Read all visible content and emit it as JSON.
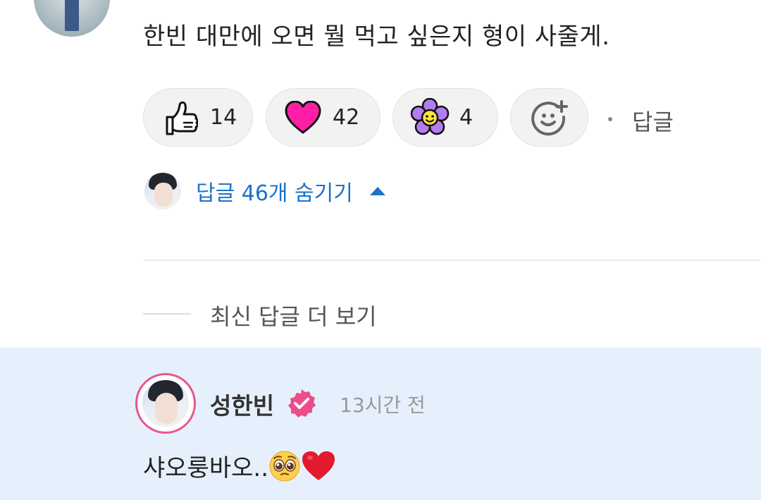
{
  "comment": {
    "text": "한빈 대만에 오면 뭘 먹고 싶은지 형이 사줄게."
  },
  "reactions": [
    {
      "icon": "thumbs-up-icon",
      "count": "14"
    },
    {
      "icon": "heart-icon",
      "count": "42",
      "color": "#ff1fa6"
    },
    {
      "icon": "flower-icon",
      "count": "4",
      "color": "#b27df0"
    },
    {
      "icon": "add-reaction-icon"
    }
  ],
  "reply_link": "답글",
  "replies_toggle": {
    "label": "답글 46개 숨기기",
    "color": "#1a73c8"
  },
  "more_replies": "최신 답글 더 보기",
  "reply": {
    "author": "성한빈",
    "time": "13시간 전",
    "text": "샤오룽바오..",
    "emojis": [
      "pleading-face-emoji",
      "red-heart-emoji"
    ],
    "highlight_color": "#e6f0fc",
    "verified_color": "#ec4d8a"
  }
}
